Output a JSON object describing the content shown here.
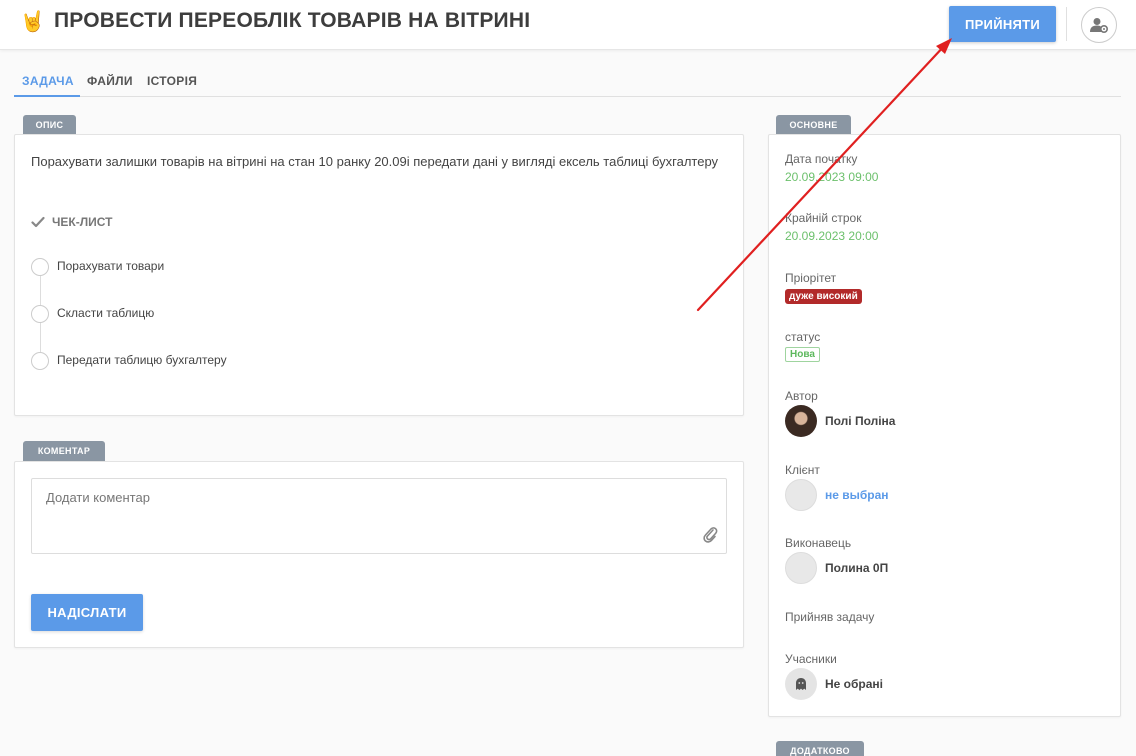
{
  "header": {
    "emoji": "🤘",
    "title": "ПРОВЕСТИ ПЕРЕОБЛІК ТОВАРІВ НА ВІТРИНІ",
    "accept_label": "ПРИЙНЯТИ",
    "accent_color": "#5b9ae8"
  },
  "tabs": [
    {
      "label": "ЗАДАЧА",
      "active": true
    },
    {
      "label": "ФАЙЛИ",
      "active": false
    },
    {
      "label": "ІСТОРІЯ",
      "active": false
    }
  ],
  "description": {
    "tag": "ОПИС",
    "text": "Порахувати залишки товарів на вітрині на стан 10 ранку 20.09і передати дані у вигляді ексель таблиці бухгалтеру",
    "checklist_title": "ЧЕК-ЛИСТ",
    "checklist": [
      {
        "label": "Порахувати товари",
        "done": false
      },
      {
        "label": "Скласти таблицю",
        "done": false
      },
      {
        "label": "Передати таблицю бухгалтеру",
        "done": false
      }
    ]
  },
  "comment": {
    "tag": "КОМЕНТАР",
    "placeholder": "Додати коментар",
    "send_label": "НАДІСЛАТИ"
  },
  "main_info": {
    "tag": "ОСНОВНЕ",
    "start_date_label": "Дата початку",
    "start_date": "20.09.2023 09:00",
    "deadline_label": "Крайній строк",
    "deadline": "20.09.2023 20:00",
    "priority_label": "Пріорітет",
    "priority": "дуже високий",
    "priority_color": "#b22a2a",
    "status_label": "статус",
    "status": "Нова",
    "status_color": "#5cb85c",
    "author_label": "Автор",
    "author": "Полі Поліна",
    "client_label": "Клієнт",
    "client": "не выбран",
    "executor_label": "Виконавець",
    "executor": "Полина 0П",
    "accepted_label": "Прийняв задачу",
    "participants_label": "Учасники",
    "participants": "Не обрані"
  },
  "extra": {
    "tag": "ДОДАТКОВО"
  }
}
